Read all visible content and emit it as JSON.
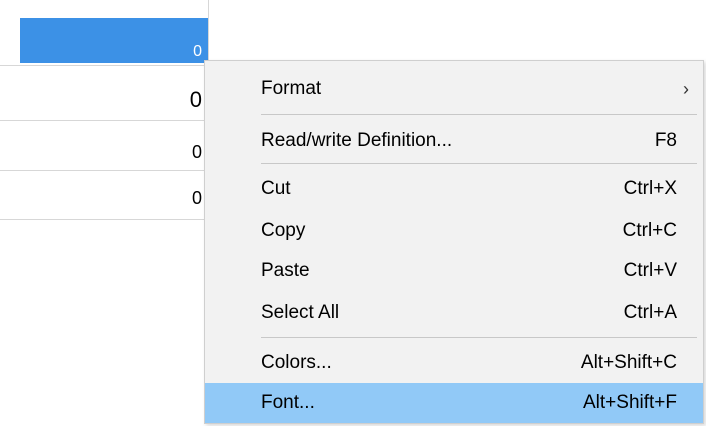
{
  "grid": {
    "cells": [
      {
        "value": "0",
        "selected": true
      },
      {
        "value": "0",
        "selected": false
      },
      {
        "value": "0",
        "selected": false
      },
      {
        "value": "0",
        "selected": false
      }
    ]
  },
  "context_menu": {
    "items": [
      {
        "label": "Format",
        "shortcut": "",
        "submenu_arrow": "›"
      },
      {
        "label": "Read/write Definition...",
        "shortcut": "F8"
      },
      {
        "label": "Cut",
        "shortcut": "Ctrl+X"
      },
      {
        "label": "Copy",
        "shortcut": "Ctrl+C"
      },
      {
        "label": "Paste",
        "shortcut": "Ctrl+V"
      },
      {
        "label": "Select All",
        "shortcut": "Ctrl+A"
      },
      {
        "label": "Colors...",
        "shortcut": "Alt+Shift+C"
      },
      {
        "label": "Font...",
        "shortcut": "Alt+Shift+F",
        "highlighted": true
      }
    ]
  },
  "colors": {
    "selected_cell": "#3c91e6",
    "menu_background": "#f2f2f2",
    "menu_highlight": "#91c9f7",
    "grid_line": "#d7d7d7"
  }
}
